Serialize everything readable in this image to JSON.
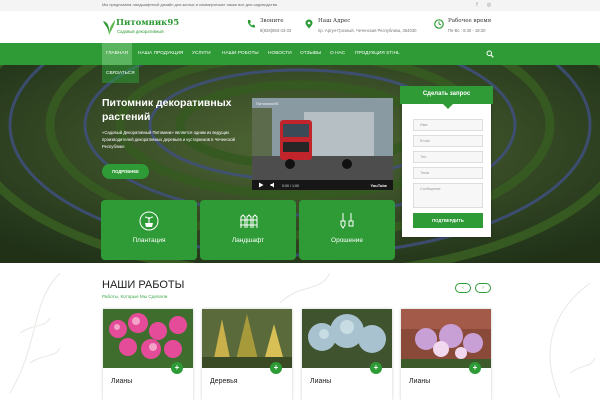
{
  "topbar": {
    "message": "Мы предлагаем ландшафтный дизайн для жилых и коммерческих также все для садоводства"
  },
  "logo": {
    "name": "Питомник95",
    "subtitle": "Садовый декоративный"
  },
  "header": {
    "phone": {
      "label": "Звоните",
      "value": "8(928)893-33-33"
    },
    "address": {
      "label": "Наш Адрес",
      "value": "пр. Аргун-Грозный, Чеченская Республика, 364030"
    },
    "hours": {
      "label": "Рабочее время",
      "value": "Пн-Вс : 8:30 - 18:30"
    }
  },
  "nav": {
    "items": [
      "ГЛАВНАЯ",
      "НАША ПРОДУКЦИЯ",
      "УСЛУГИ",
      "НАШИ РОБОТЫ",
      "НОВОСТИ",
      "ОТЗЫВЫ",
      "О НАС",
      "ПРОДУКЦИЯ STIHL"
    ],
    "second_row": "СВЯЗАТЬСЯ"
  },
  "hero": {
    "title": "Питомник декоративных растений",
    "description": "«Садовый Декоративный Питомник» является одним из ведущих производителей декоративных деревьев и кустарников в Чеченской Республике",
    "button": "ПОДРОБНЕЕ"
  },
  "video": {
    "title": "Питомник95",
    "time": "0:00 / 1:00",
    "brand": "YouTube"
  },
  "form": {
    "title": "Сделать запрос",
    "fields": [
      "Имя",
      "Email",
      "Тел",
      "Тема",
      "Сообщение"
    ],
    "submit": "ПОДТВЕРДИТЬ"
  },
  "services": [
    "Плантация",
    "Ландшафт",
    "Орошение"
  ],
  "works": {
    "title": "НАШИ РАБОТЫ",
    "subtitle": "Работы, Которые Мы Сделали",
    "prev": "‹",
    "next": "›",
    "cards": [
      "Лианы",
      "Деревья",
      "Лианы",
      "Лианы"
    ]
  },
  "colors": {
    "brand_green": "#2e9b36",
    "active_nav": "#5bb45f"
  }
}
